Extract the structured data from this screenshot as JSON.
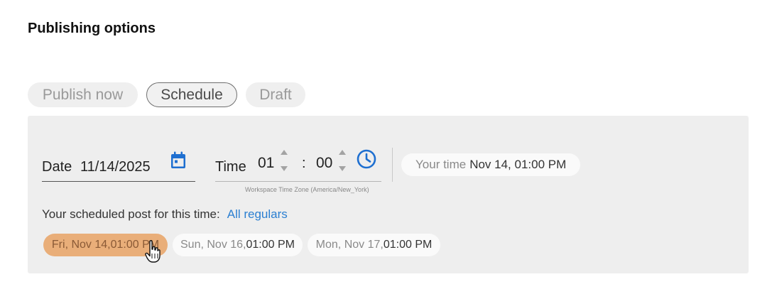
{
  "section": {
    "title": "Publishing options"
  },
  "mode_tabs": {
    "publish_now": "Publish now",
    "schedule": "Schedule",
    "draft": "Draft",
    "selected": "Schedule"
  },
  "date": {
    "label": "Date",
    "value": "11/14/2025"
  },
  "time": {
    "label": "Time",
    "hour": "01",
    "minute": "00",
    "separator": ":",
    "timezone_caption": "Workspace Time Zone (America/New_York)"
  },
  "your_time": {
    "label": "Your time",
    "value": "Nov 14, 01:00 PM"
  },
  "scheduled": {
    "text": "Your scheduled post for this time:",
    "link": "All regulars"
  },
  "slots": [
    {
      "day": "Fri, Nov 14, ",
      "time": "01:00 PM",
      "selected": true
    },
    {
      "day": "Sun, Nov 16, ",
      "time": "01:00 PM",
      "selected": false
    },
    {
      "day": "Mon, Nov 17, ",
      "time": "01:00 PM",
      "selected": false
    }
  ],
  "colors": {
    "accent_blue": "#2b7fd1",
    "selected_slot": "#e9ae79",
    "panel_bg": "#eeeeee"
  },
  "icons": {
    "calendar": "calendar-icon",
    "clock": "clock-icon",
    "stepper": "chevron-up-down-icon",
    "pointer": "hand-pointer-icon"
  }
}
